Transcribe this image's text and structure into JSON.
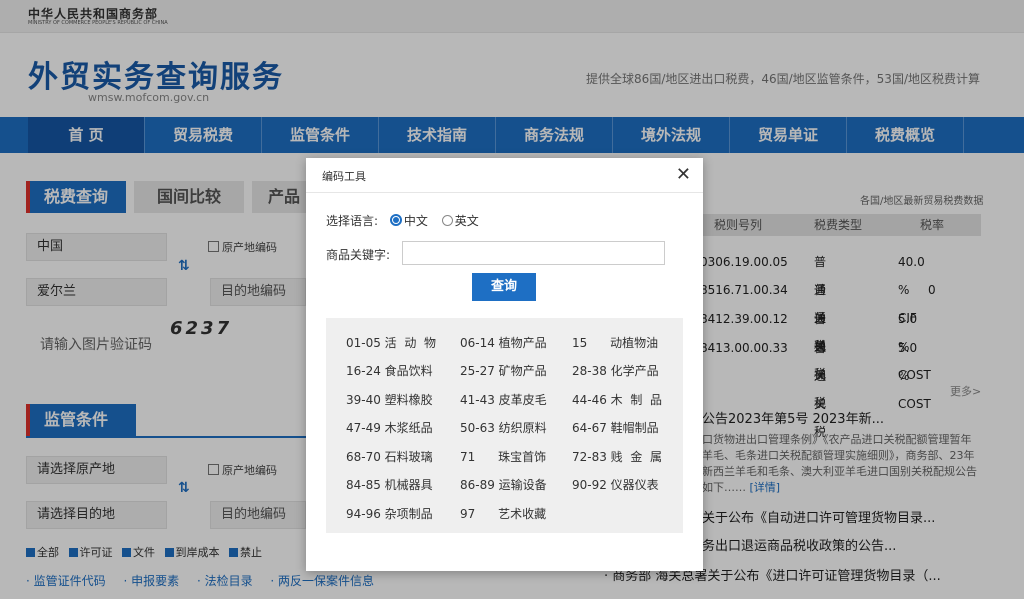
{
  "header": {
    "ministry_cn": "中华人民共和国商务部",
    "ministry_en": "MINISTRY OF COMMERCE PEOPLE'S REPUBLIC OF CHINA",
    "site_title": "外贸实务查询服务",
    "site_url": "wmsw.mofcom.gov.cn",
    "slogan": "提供全球86国/地区进出口税费，46国/地区监管条件，53国/地区税费计算"
  },
  "nav": [
    "首 页",
    "贸易税费",
    "监管条件",
    "技术指南",
    "商务法规",
    "境外法规",
    "贸易单证",
    "税费概览"
  ],
  "fee_tabs": {
    "active": "税费查询",
    "second": "国间比较",
    "third": "产品"
  },
  "fee_form": {
    "origin": "中国",
    "origin_code_label": "原产地编码",
    "dest": "爱尔兰",
    "dest_code_placeholder": "目的地编码",
    "captcha_placeholder": "请输入图片验证码",
    "captcha_text": "6237"
  },
  "supervision": {
    "title": "监管条件",
    "origin_placeholder": "请选择原产地",
    "origin_code_label": "原产地编码",
    "dest_placeholder": "请选择目的地",
    "dest_code_placeholder": "目的地编码",
    "filters": [
      "全部",
      "许可证",
      "文件",
      "到岸成本",
      "禁止"
    ],
    "links": [
      "· 监管证件代码",
      "· 申报要素",
      "· 法检目录",
      "· 两反一保案件信息"
    ]
  },
  "right": {
    "header": "各国/地区最新贸易税费数据",
    "columns": [
      "税则号列",
      "税费类型",
      "税率"
    ],
    "rows": [
      [
        "0306.19.00.05",
        "普通关税",
        "40.0 % CIF"
      ],
      [
        "8516.71.00.34",
        "普通关税",
        "0"
      ],
      [
        "8412.39.00.12",
        "普通关税",
        "5.0 % COST"
      ],
      [
        "8413.00.00.33",
        "普通关税",
        "5.0 % COST"
      ]
    ],
    "more": "更多>",
    "news_title": "公告2023年第5号 2023年新...",
    "news_body": "口货物进出口管理条例》《农产品进口关税配额管理暂年羊毛、毛条进口关税配额管理实施细则》，商务部、23年新西兰羊毛和毛条、澳大利亚羊毛进口国别关税配规公告如下……",
    "news_detail": "[详情]",
    "news_items": [
      "关于公布《自动进口许可管理货物目录...",
      "务出口退运商品税收政策的公告..."
    ],
    "news_bottom": "· 商务部 海关总署关于公布《进口许可证管理货物目录（..."
  },
  "modal": {
    "title": "编码工具",
    "lang_label": "选择语言:",
    "lang_cn": "中文",
    "lang_en": "英文",
    "keyword_label": "商品关键字:",
    "keyword_value": "",
    "search_label": "查询",
    "categories": [
      "01-05 活  动  物",
      "06-14 植物产品",
      "15      动植物油",
      "16-24 食品饮料",
      "25-27 矿物产品",
      "28-38 化学产品",
      "39-40 塑料橡胶",
      "41-43 皮革皮毛",
      "44-46 木  制  品",
      "47-49 木浆纸品",
      "50-63 纺织原料",
      "64-67 鞋帽制品",
      "68-70 石料玻璃",
      "71      珠宝首饰",
      "72-83 贱  金  属",
      "84-85 机械器具",
      "86-89 运输设备",
      "90-92 仪器仪表",
      "94-96 杂项制品",
      "97      艺术收藏"
    ]
  }
}
